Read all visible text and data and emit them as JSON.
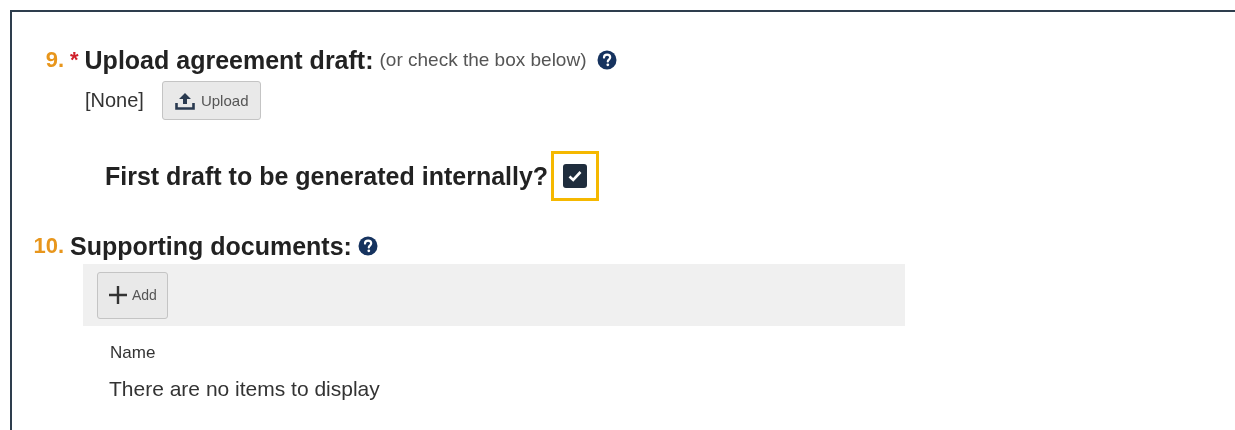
{
  "questions": [
    {
      "kind": "upload",
      "number": "9.",
      "required_mark": "*",
      "title": "Upload agreement draft:",
      "hint": "(or check the box below)",
      "help": true,
      "file": {
        "value": "[None]",
        "button": "Upload"
      },
      "checkbox": {
        "label": "First draft to be generated internally?",
        "checked": true,
        "highlighted": true
      }
    },
    {
      "kind": "documents",
      "number": "10.",
      "title": "Supporting documents:",
      "help": true,
      "documents": {
        "add_button": "Add",
        "columns": [
          "Name"
        ],
        "empty_message": "There are no items to display"
      }
    }
  ]
}
